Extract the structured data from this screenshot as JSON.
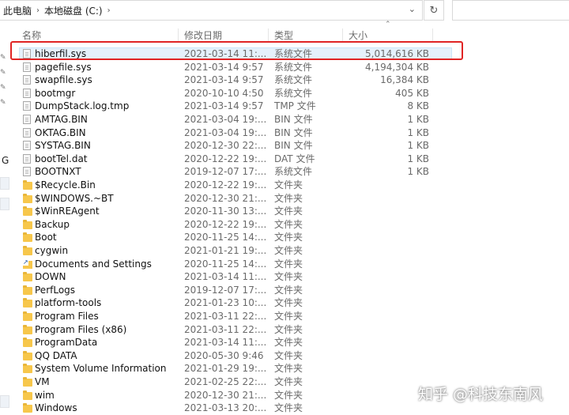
{
  "breadcrumb": [
    "此电脑",
    "本地磁盘 (C:)"
  ],
  "columns": {
    "name": "名称",
    "date": "修改日期",
    "type": "类型",
    "size": "大小"
  },
  "nav_letter": "G",
  "files": [
    {
      "name": "hiberfil.sys",
      "date": "2021-03-14 11:...",
      "type": "系统文件",
      "size": "5,014,616 KB",
      "icon": "file",
      "selected": true
    },
    {
      "name": "pagefile.sys",
      "date": "2021-03-14 9:57",
      "type": "系统文件",
      "size": "4,194,304 KB",
      "icon": "file"
    },
    {
      "name": "swapfile.sys",
      "date": "2021-03-14 9:57",
      "type": "系统文件",
      "size": "16,384 KB",
      "icon": "file"
    },
    {
      "name": "bootmgr",
      "date": "2020-10-10 4:50",
      "type": "系统文件",
      "size": "405 KB",
      "icon": "file"
    },
    {
      "name": "DumpStack.log.tmp",
      "date": "2021-03-14 9:57",
      "type": "TMP 文件",
      "size": "8 KB",
      "icon": "file"
    },
    {
      "name": "AMTAG.BIN",
      "date": "2021-03-04 19:...",
      "type": "BIN 文件",
      "size": "1 KB",
      "icon": "file"
    },
    {
      "name": "OKTAG.BIN",
      "date": "2021-03-04 19:...",
      "type": "BIN 文件",
      "size": "1 KB",
      "icon": "file"
    },
    {
      "name": "SYSTAG.BIN",
      "date": "2020-12-30 22:...",
      "type": "BIN 文件",
      "size": "1 KB",
      "icon": "file"
    },
    {
      "name": "bootTel.dat",
      "date": "2020-12-22 19:...",
      "type": "DAT 文件",
      "size": "1 KB",
      "icon": "file"
    },
    {
      "name": "BOOTNXT",
      "date": "2019-12-07 17:...",
      "type": "系统文件",
      "size": "1 KB",
      "icon": "file"
    },
    {
      "name": "$Recycle.Bin",
      "date": "2020-12-22 19:...",
      "type": "文件夹",
      "size": "",
      "icon": "folder"
    },
    {
      "name": "$WINDOWS.~BT",
      "date": "2020-12-30 21:...",
      "type": "文件夹",
      "size": "",
      "icon": "folder"
    },
    {
      "name": "$WinREAgent",
      "date": "2020-11-30 13:...",
      "type": "文件夹",
      "size": "",
      "icon": "folder"
    },
    {
      "name": "Backup",
      "date": "2020-12-22 19:...",
      "type": "文件夹",
      "size": "",
      "icon": "folder"
    },
    {
      "name": "Boot",
      "date": "2020-11-25 14:...",
      "type": "文件夹",
      "size": "",
      "icon": "folder"
    },
    {
      "name": "cygwin",
      "date": "2021-01-21 19:...",
      "type": "文件夹",
      "size": "",
      "icon": "folder"
    },
    {
      "name": "Documents and Settings",
      "date": "2020-11-25 14:...",
      "type": "文件夹",
      "size": "",
      "icon": "shortcut"
    },
    {
      "name": "DOWN",
      "date": "2021-03-14 11:...",
      "type": "文件夹",
      "size": "",
      "icon": "folder"
    },
    {
      "name": "PerfLogs",
      "date": "2019-12-07 17:...",
      "type": "文件夹",
      "size": "",
      "icon": "folder"
    },
    {
      "name": "platform-tools",
      "date": "2021-01-23 10:...",
      "type": "文件夹",
      "size": "",
      "icon": "folder"
    },
    {
      "name": "Program Files",
      "date": "2021-03-11 22:...",
      "type": "文件夹",
      "size": "",
      "icon": "folder"
    },
    {
      "name": "Program Files (x86)",
      "date": "2021-03-11 22:...",
      "type": "文件夹",
      "size": "",
      "icon": "folder"
    },
    {
      "name": "ProgramData",
      "date": "2021-03-14 11:...",
      "type": "文件夹",
      "size": "",
      "icon": "folder"
    },
    {
      "name": "QQ DATA",
      "date": "2020-05-30 9:46",
      "type": "文件夹",
      "size": "",
      "icon": "folder"
    },
    {
      "name": "System Volume Information",
      "date": "2021-01-29 19:...",
      "type": "文件夹",
      "size": "",
      "icon": "folder"
    },
    {
      "name": "VM",
      "date": "2021-02-25 22:...",
      "type": "文件夹",
      "size": "",
      "icon": "folder"
    },
    {
      "name": "wim",
      "date": "2020-12-30 21:...",
      "type": "文件夹",
      "size": "",
      "icon": "folder"
    },
    {
      "name": "Windows",
      "date": "2021-03-13 20:...",
      "type": "文件夹",
      "size": "",
      "icon": "folder"
    }
  ],
  "watermark": "知乎 @科技东南风",
  "colors": {
    "highlight": "#e02424",
    "folder": "#f7c74b",
    "selection": "#e5f1fb"
  }
}
